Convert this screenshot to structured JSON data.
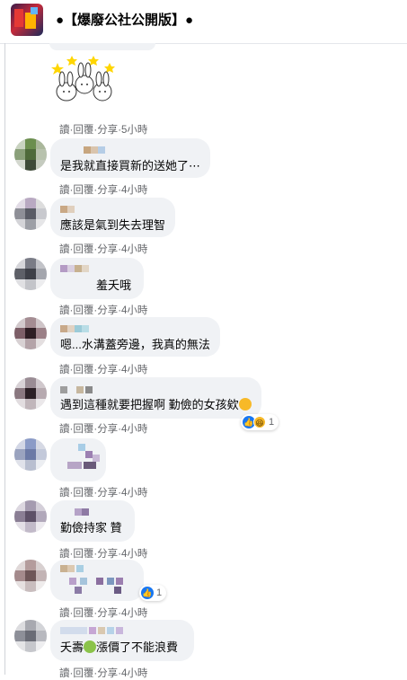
{
  "header": {
    "title": "●【爆廢公社公開版】●"
  },
  "actions": {
    "read": "讀",
    "reply": "回覆",
    "share": "分享",
    "sep": " · "
  },
  "colors": {
    "bubble": "#f0f2f5",
    "meta": "#65676b",
    "like": "#1877f2"
  },
  "comments": [
    {
      "text": "",
      "time": "5小時"
    },
    {
      "text": "是我就直接買新的送她了⋯",
      "time": "4小時"
    },
    {
      "text": "應該是氣到失去理智",
      "time": "4小時"
    },
    {
      "text": "羞夭哦",
      "time": "4小時"
    },
    {
      "text": "嗯...水溝蓋旁邊，我真的無法",
      "time": "4小時"
    },
    {
      "text": "遇到這種就要把握啊 勤儉的女孩欸",
      "time": "4小時",
      "reactions": "1"
    },
    {
      "text": "",
      "time": "4小時"
    },
    {
      "text": "勤儉持家 贊",
      "time": "4小時"
    },
    {
      "text": "",
      "time": "4小時",
      "reactions": "1"
    },
    {
      "text": "夭壽",
      "text2": "漲價了不能浪費",
      "time": "4小時"
    }
  ]
}
